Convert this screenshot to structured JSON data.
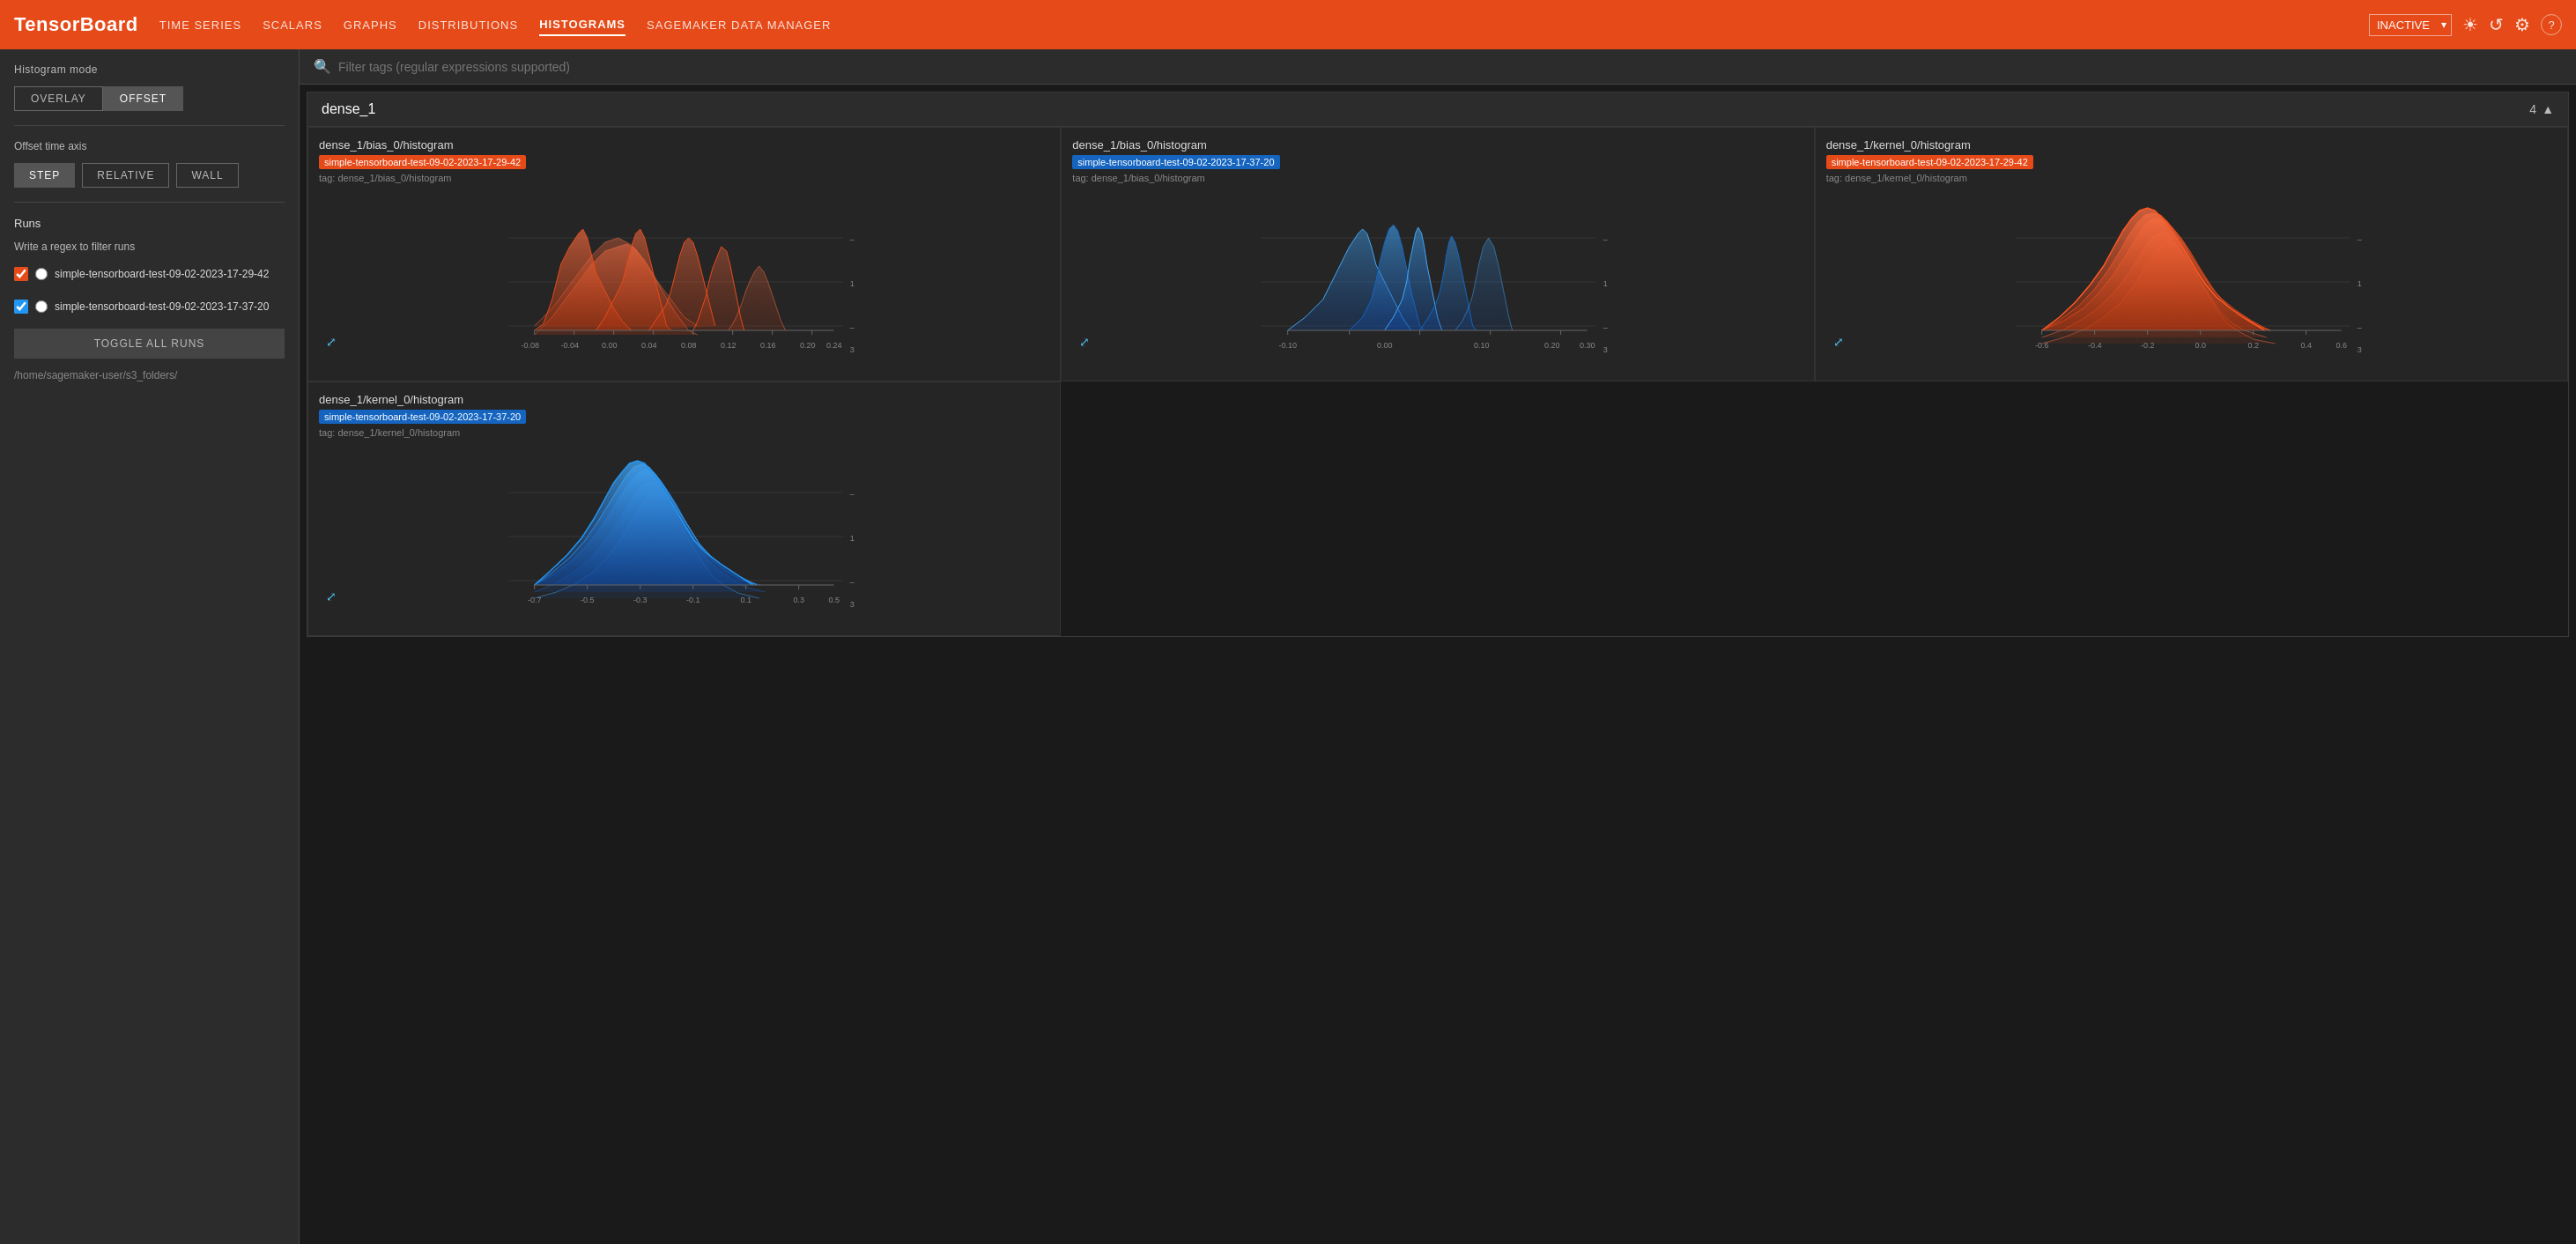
{
  "app": {
    "logo": "TensorBoard"
  },
  "nav": {
    "items": [
      {
        "label": "TIME SERIES",
        "active": false
      },
      {
        "label": "SCALARS",
        "active": false
      },
      {
        "label": "GRAPHS",
        "active": false
      },
      {
        "label": "DISTRIBUTIONS",
        "active": false
      },
      {
        "label": "HISTOGRAMS",
        "active": true
      },
      {
        "label": "SAGEMAKER DATA MANAGER",
        "active": false
      }
    ]
  },
  "header": {
    "inactive_label": "INACTIVE",
    "refresh_icon": "↺",
    "settings_icon": "⚙",
    "help_icon": "?"
  },
  "sidebar": {
    "histogram_mode_label": "Histogram mode",
    "overlay_label": "OVERLAY",
    "offset_label": "OFFSET",
    "offset_axis_label": "Offset time axis",
    "step_label": "STEP",
    "relative_label": "RELATIVE",
    "wall_label": "WALL",
    "runs_label": "Runs",
    "regex_label": "Write a regex to filter runs",
    "run1": "simple-tensorboard-test-09-02-2023-17-29-42",
    "run2": "simple-tensorboard-test-09-02-2023-17-37-20",
    "toggle_all_label": "TOGGLE ALL RUNS",
    "folder_path": "/home/sagemaker-user/s3_folders/"
  },
  "search": {
    "placeholder": "Filter tags (regular expressions supported)"
  },
  "sections": [
    {
      "title": "dense_1",
      "count": "4",
      "charts": [
        {
          "title": "dense_1/bias_0/histogram",
          "badge": "simple-tensorboard-test-09-02-2023-17-29-42",
          "badge_type": "orange",
          "tag": "tag: dense_1/bias_0/histogram",
          "type": "spike_orange",
          "x_labels": [
            "-0.08",
            "-0.04",
            "0.00",
            "0.04",
            "0.08",
            "0.12",
            "0.16",
            "0.20",
            "0.24"
          ],
          "y_labels": [
            "-",
            "1",
            "-",
            "3"
          ]
        },
        {
          "title": "dense_1/bias_0/histogram",
          "badge": "simple-tensorboard-test-09-02-2023-17-37-20",
          "badge_type": "blue",
          "tag": "tag: dense_1/bias_0/histogram",
          "type": "spike_blue",
          "x_labels": [
            "-0.10",
            "0.00",
            "0.10",
            "0.20",
            "0.30"
          ],
          "y_labels": [
            "-",
            "1",
            "-",
            "3"
          ]
        },
        {
          "title": "dense_1/kernel_0/histogram",
          "badge": "simple-tensorboard-test-09-02-2023-17-29-42",
          "badge_type": "orange",
          "tag": "tag: dense_1/kernel_0/histogram",
          "type": "mountain_orange",
          "x_labels": [
            "-0.6",
            "-0.4",
            "-0.2",
            "0.0",
            "0.2",
            "0.4",
            "0.6"
          ],
          "y_labels": [
            "-",
            "1",
            "-",
            "3"
          ]
        },
        {
          "title": "dense_1/kernel_0/histogram",
          "badge": "simple-tensorboard-test-09-02-2023-17-37-20",
          "badge_type": "blue",
          "tag": "tag: dense_1/kernel_0/histogram",
          "type": "mountain_blue",
          "x_labels": [
            "-0.7",
            "-0.5",
            "-0.3",
            "-0.1",
            "0.1",
            "0.3",
            "0.5"
          ],
          "y_labels": [
            "-",
            "1",
            "-",
            "3"
          ]
        }
      ]
    }
  ]
}
